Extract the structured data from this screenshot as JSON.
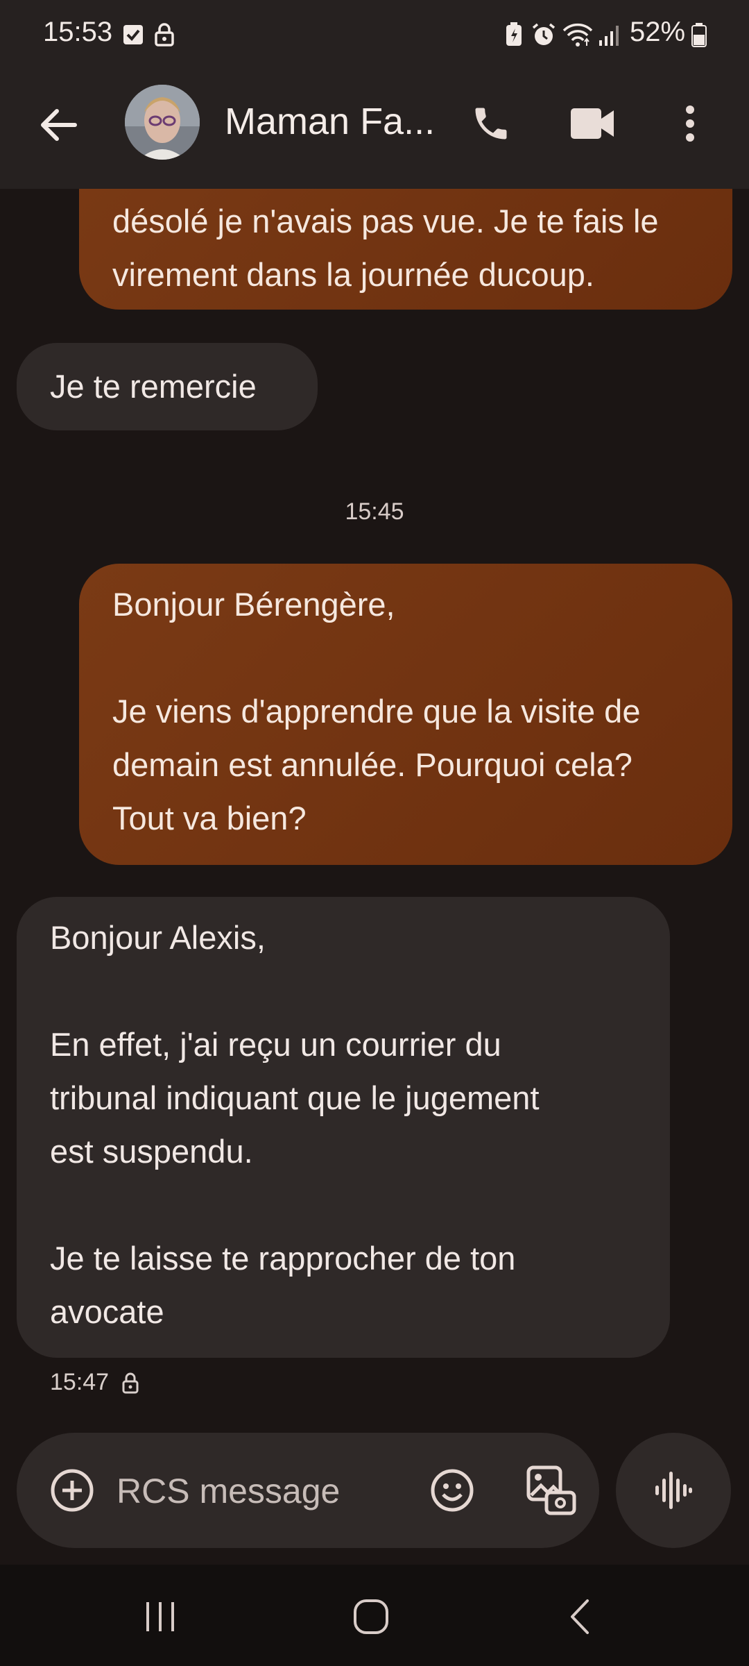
{
  "status_bar": {
    "time": "15:53",
    "battery_percent": "52%",
    "icons": [
      "checkbox-notification-icon",
      "lock-notification-icon",
      "battery-saver-icon",
      "alarm-icon",
      "wifi-icon",
      "signal-icon",
      "battery-icon"
    ]
  },
  "header": {
    "contact_name": "Maman Fa...",
    "back_icon": "arrow-back-icon",
    "call_icon": "phone-icon",
    "video_icon": "videocam-icon",
    "more_icon": "more-vert-icon"
  },
  "messages": [
    {
      "direction": "outgoing",
      "text": "désolé je n'avais pas vue. Je te fais le\nvirement dans la journée ducoup."
    },
    {
      "direction": "incoming",
      "text": "Je te remercie"
    },
    {
      "direction": "timestamp",
      "text": "15:45"
    },
    {
      "direction": "outgoing",
      "text": "Bonjour Bérengère,\n\nJe viens d'apprendre que la visite de\ndemain est annulée. Pourquoi cela?\nTout va bien?"
    },
    {
      "direction": "incoming",
      "text": "Bonjour Alexis,\n\nEn effet, j'ai reçu un courrier du\ntribunal indiquant que le jugement\nest suspendu.\n\nJe te laisse te rapprocher de ton\navocate",
      "time": "15:47"
    }
  ],
  "composer": {
    "placeholder": "RCS message",
    "value": "",
    "icons": [
      "add-circle-icon",
      "emoji-icon",
      "gallery-icon",
      "voice-waveform-icon"
    ]
  },
  "colors": {
    "background": "#1b1514",
    "outgoing_bubble": "#6f3110",
    "incoming_bubble": "#2f2928",
    "header": "#262120"
  }
}
